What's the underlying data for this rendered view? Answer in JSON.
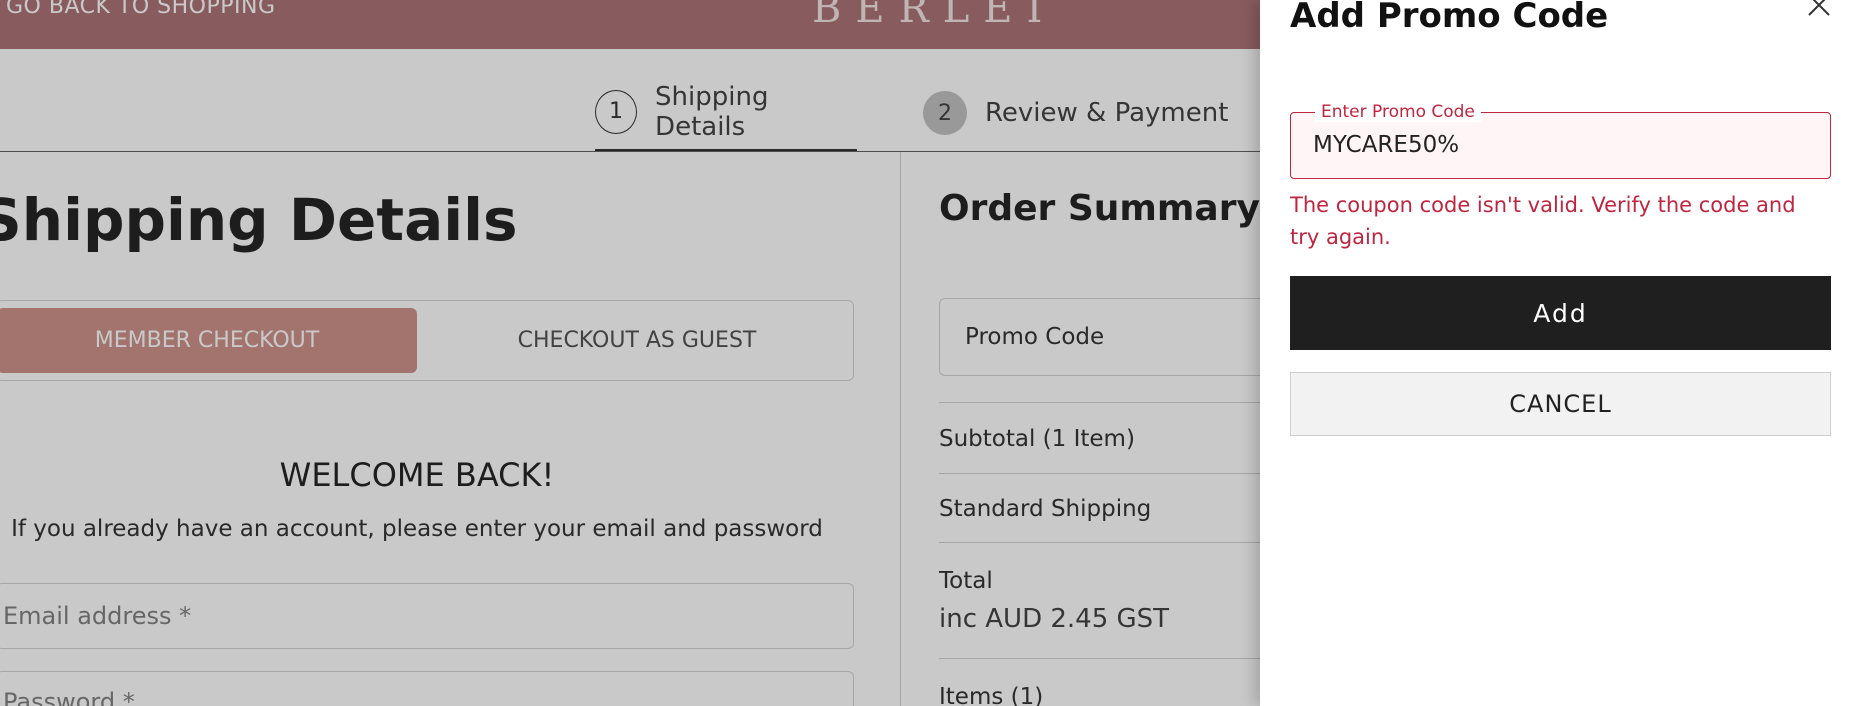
{
  "header": {
    "back_link": "GO BACK TO SHOPPING",
    "brand": "BERLEI"
  },
  "steps": [
    {
      "number": "1",
      "label": "Shipping Details"
    },
    {
      "number": "2",
      "label": "Review & Payment"
    }
  ],
  "shipping": {
    "title": "Shipping Details",
    "member_checkout": "MEMBER CHECKOUT",
    "guest_checkout": "CHECKOUT AS GUEST",
    "welcome_title": "WELCOME BACK!",
    "welcome_sub": "If you already have an account, please enter your email and password",
    "email_placeholder": "Email address *",
    "password_placeholder": "Password *"
  },
  "order_summary": {
    "title": "Order Summary",
    "promo_label": "Promo Code",
    "subtotal": "Subtotal (1 Item)",
    "shipping": "Standard Shipping",
    "total": "Total",
    "total_tax": "inc AUD 2.45 GST",
    "items": "Items (1)"
  },
  "drawer": {
    "title": "Add Promo Code",
    "field_label": "Enter Promo Code",
    "field_value": "MYCARE50%",
    "error": "The coupon code isn't valid. Verify the code and try again.",
    "add_label": "Add",
    "cancel_label": "CANCEL"
  },
  "colors": {
    "header_bg": "#a5696b",
    "member_btn": "#c98a80",
    "error": "#c0253f",
    "add_btn": "#1f1f1f"
  }
}
